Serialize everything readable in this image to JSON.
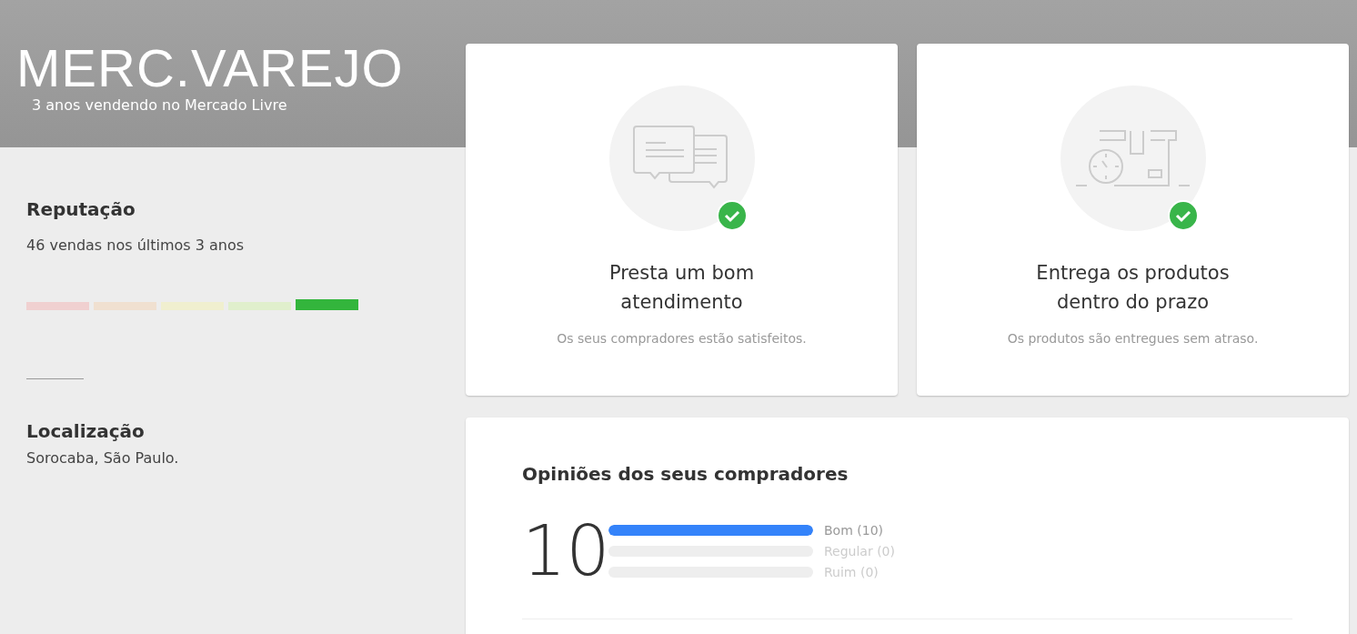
{
  "header": {
    "title": "MERC.VAREJO",
    "subtitle": "3 anos vendendo no Mercado Livre"
  },
  "reputation": {
    "title": "Reputação",
    "sales": "46 vendas nos últimos 3 anos",
    "segments": [
      {
        "color": "#f0d0d0",
        "selected": false
      },
      {
        "color": "#f0e0d0",
        "selected": false
      },
      {
        "color": "#f0efcf",
        "selected": false
      },
      {
        "color": "#e0efcc",
        "selected": false
      },
      {
        "color": "#33b53c",
        "selected": true
      }
    ]
  },
  "location": {
    "title": "Localização",
    "value": "Sorocaba, São Paulo."
  },
  "highlights": [
    {
      "kind": "chat",
      "title": "Presta um bom\natendimento",
      "description": "Os seus compradores estão satisfeitos.",
      "checked": true
    },
    {
      "kind": "delivery",
      "title": "Entrega os produtos\ndentro do prazo",
      "description": "Os produtos são entregues sem atraso.",
      "checked": true
    }
  ],
  "opinions": {
    "title": "Opiniões dos seus compradores",
    "total": "10",
    "rows": [
      {
        "label": "Bom (10)",
        "level": 1,
        "active": true
      },
      {
        "label": "Regular (0)",
        "level": 0,
        "active": false
      },
      {
        "label": "Ruim (0)",
        "level": 0,
        "active": false
      }
    ]
  }
}
